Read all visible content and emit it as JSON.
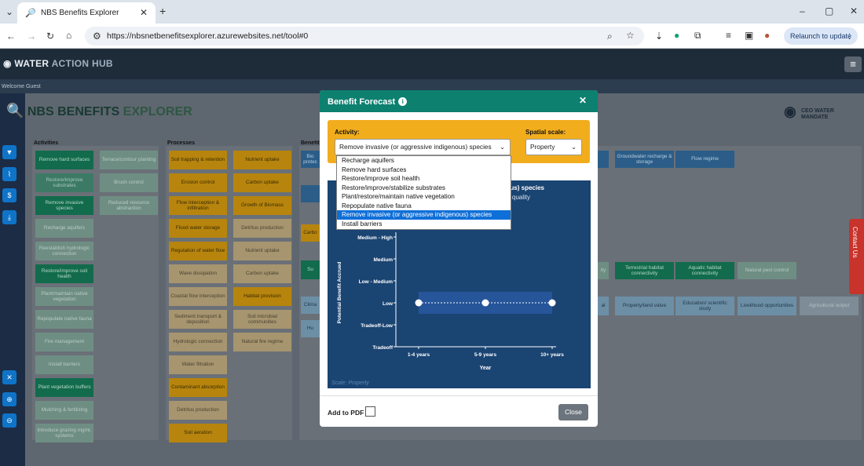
{
  "browser": {
    "tab_title": "NBS Benefits Explorer",
    "url": "https://nbsnetbenefitsexplorer.azurewebsites.net/tool#0",
    "relaunch_label": "Relaunch to update"
  },
  "app": {
    "logo_bold": "WATER",
    "logo_rest": "ACTION HUB",
    "welcome": "Welcome Guest",
    "title_1": "NBS BENEFITS ",
    "title_2": "EXPLORER",
    "partner_logo": "CEO WATER MANDATE",
    "col_activities": "Activities",
    "col_processes": "Processes",
    "col_benefits": "Benefits"
  },
  "activities": [
    [
      "Remove hard surfaces",
      "dark"
    ],
    [
      "Terrace/contour planting",
      "light"
    ],
    [
      "Restore/improve substrates",
      "mid"
    ],
    [
      "Brush control",
      "light"
    ],
    [
      "Remove invasive species",
      "dark"
    ],
    [
      "Reduced resource abstraction",
      "light"
    ],
    [
      "Recharge aquifers",
      "light"
    ],
    [
      "",
      ""
    ],
    [
      "Reestablish hydrologic connection",
      "light"
    ],
    [
      "",
      ""
    ],
    [
      "Restore/improve soil health",
      "dark"
    ],
    [
      "",
      ""
    ],
    [
      "Plant/maintain native vegetation",
      "light"
    ],
    [
      "",
      ""
    ],
    [
      "Repopulate native fauna",
      "light"
    ],
    [
      "",
      ""
    ],
    [
      "Fire management",
      "light"
    ],
    [
      "",
      ""
    ],
    [
      "Install barriers",
      "light"
    ],
    [
      "",
      ""
    ],
    [
      "Plant vegetation buffers",
      "dark"
    ],
    [
      "",
      ""
    ],
    [
      "Mulching & fertilizing",
      "light"
    ],
    [
      "",
      ""
    ],
    [
      "Introduce grazing mgmt. systems",
      "light"
    ],
    [
      "",
      ""
    ]
  ],
  "processes": [
    [
      "Soil trapping & retention",
      "dark"
    ],
    [
      "Nutrient uptake",
      "dark"
    ],
    [
      "Erosion control",
      "dark"
    ],
    [
      "Carbon uptake",
      "dark"
    ],
    [
      "Flow interception & infiltration",
      "dark"
    ],
    [
      "Growth of Biomass",
      "dark"
    ],
    [
      "Flood water storage",
      "dark"
    ],
    [
      "Detritus production",
      "light"
    ],
    [
      "Regulation of water flow",
      "dark"
    ],
    [
      "Nutrient uptake",
      "light"
    ],
    [
      "Wave dissipation",
      "light"
    ],
    [
      "Carbon uptake",
      "light"
    ],
    [
      "Coastal flow interception",
      "light"
    ],
    [
      "Habitat provision",
      "dark"
    ],
    [
      "Sediment transport & deposition",
      "light"
    ],
    [
      "Soil microbial communities",
      "light"
    ],
    [
      "Hydrologic connection",
      "light"
    ],
    [
      "Natural fire regime",
      "light"
    ],
    [
      "Water filtration",
      "light"
    ],
    [
      "",
      ""
    ],
    [
      "Contaminant absorption",
      "dark"
    ],
    [
      "",
      ""
    ],
    [
      "Detritus production",
      "light"
    ],
    [
      "",
      ""
    ],
    [
      "Soil aeration",
      "dark"
    ],
    [
      "",
      ""
    ]
  ],
  "benefits_visible": {
    "b1": "Groundwater recharge & storage",
    "b2": "Flow regime",
    "b3": "Terrestrial habitat connectivity",
    "b4": "Aquatic habitat connectivity",
    "b5": "Natural pest control",
    "b6": "Property/land value",
    "b7": "Education/ scientific study",
    "b8": "Livelihood opportunities",
    "b9": "Agricultural output",
    "l1": "Bio protec",
    "l2": "Carbo",
    "l3": "Su",
    "l4": "Clima",
    "l5": "Hu",
    "r1": "ity",
    "r2": "al"
  },
  "modal": {
    "title": "Benefit Forecast",
    "activity_label": "Activity:",
    "activity_value": "Remove invasive (or aggressive indigenous) species",
    "scale_label": "Spatial scale:",
    "scale_value": "Property",
    "add_pdf_label": "Add to PDF",
    "close_label": "Close",
    "options": [
      "Recharge aquifers",
      "Remove hard surfaces",
      "Restore/improve soil health",
      "Restore/improve/stabilize substrates",
      "Plant/restore/maintain native vegetation",
      "Repopulate native fauna",
      "Remove invasive (or aggressive indigenous) species",
      "Install barriers"
    ],
    "selected_option_index": 6
  },
  "chart_data": {
    "type": "line",
    "title_visible": "us) species",
    "subtitle_visible": "quality",
    "xlabel": "Year",
    "ylabel": "Potential Benefit Accrued",
    "categories": [
      "1-4 years",
      "5-9 years",
      "10+ years"
    ],
    "y_ticks": [
      "Tradeoff",
      "Tradeoff-Low",
      "Low",
      "Low - Medium",
      "Medium",
      "Medium - High"
    ],
    "series": [
      {
        "values": [
          "Low",
          "Low",
          "Low"
        ]
      }
    ],
    "band": "Low",
    "caption": "Scale: Property",
    "colors": {
      "background": "#1a4472",
      "band": "#26559a",
      "line": "#ffffff"
    }
  },
  "contact": "Contact Us"
}
